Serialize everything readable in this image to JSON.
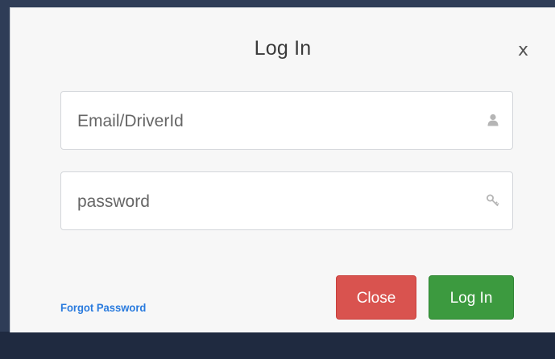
{
  "modal": {
    "title": "Log In",
    "close_x": "x",
    "email_placeholder": "Email/DriverId",
    "password_placeholder": "password",
    "forgot_label": "Forgot Password",
    "close_button_label": "Close",
    "login_button_label": "Log In"
  },
  "icons": {
    "email": "user-icon",
    "password": "key-icon",
    "dismiss": "close-icon"
  },
  "colors": {
    "close_button": "#d9534f",
    "login_button": "#3c9a3f",
    "link": "#2a7bde",
    "backdrop": "#2f3d57"
  }
}
